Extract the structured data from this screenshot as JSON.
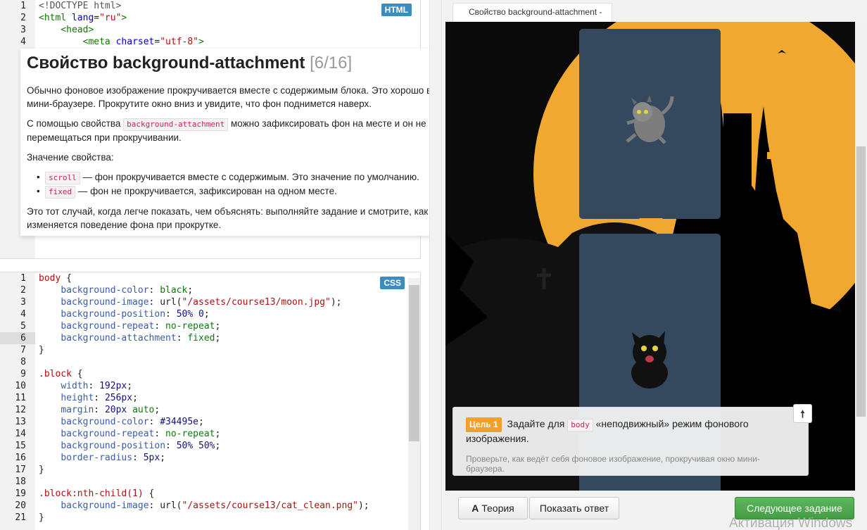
{
  "html_editor": {
    "badge": "HTML",
    "lines": [
      {
        "n": "1",
        "parts": [
          {
            "c": "t-doc",
            "t": "<!DOCTYPE html>"
          }
        ]
      },
      {
        "n": "2",
        "parts": [
          {
            "c": "t-tag",
            "t": "<html "
          },
          {
            "c": "t-attr",
            "t": "lang"
          },
          {
            "c": "t-plain",
            "t": "="
          },
          {
            "c": "t-str",
            "t": "\"ru\""
          },
          {
            "c": "t-tag",
            "t": ">"
          }
        ]
      },
      {
        "n": "3",
        "parts": [
          {
            "c": "t-plain",
            "t": "    "
          },
          {
            "c": "t-tag",
            "t": "<head>"
          }
        ]
      },
      {
        "n": "4",
        "parts": [
          {
            "c": "t-plain",
            "t": "        "
          },
          {
            "c": "t-tag",
            "t": "<meta "
          },
          {
            "c": "t-attr",
            "t": "charset"
          },
          {
            "c": "t-plain",
            "t": "="
          },
          {
            "c": "t-str",
            "t": "\"utf-8\""
          },
          {
            "c": "t-tag",
            "t": ">"
          }
        ]
      }
    ],
    "hidden_line_numbers": [
      "1",
      "1",
      "1",
      "1"
    ]
  },
  "theory": {
    "title": "Свойство background-attachment",
    "counter": "[6/16]",
    "p1": "Обычно фоновое изображение прокручивается вместе с содержимым блока. Это хорошо видно в мини-браузере. Прокрутите окно вниз и увидите, что фон поднимется наверх.",
    "p2_before": "С помощью свойства",
    "p2_code": "background-attachment",
    "p2_after": "можно зафиксировать фон на месте и он не будет перемещаться при прокручивании.",
    "p3": "Значение свойства:",
    "items": [
      {
        "code": "scroll",
        "text": "— фон прокручивается вместе с содержимым. Это значение по умолчанию."
      },
      {
        "code": "fixed",
        "text": "— фон не прокручивается, зафиксирован на одном месте."
      }
    ],
    "p4": "Это тот случай, когда легче показать, чем объяснять: выполняйте задание и смотрите, как изменяется поведение фона при прокрутке."
  },
  "css_editor": {
    "badge": "CSS",
    "active_line": "6",
    "lines": [
      {
        "n": "1",
        "parts": [
          {
            "c": "t-sel",
            "t": "body"
          },
          {
            "c": "t-plain",
            "t": " {"
          }
        ]
      },
      {
        "n": "2",
        "parts": [
          {
            "c": "t-plain",
            "t": "    "
          },
          {
            "c": "t-prop",
            "t": "background-color"
          },
          {
            "c": "t-plain",
            "t": ": "
          },
          {
            "c": "t-kw",
            "t": "black"
          },
          {
            "c": "t-plain",
            "t": ";"
          }
        ]
      },
      {
        "n": "3",
        "parts": [
          {
            "c": "t-plain",
            "t": "    "
          },
          {
            "c": "t-prop",
            "t": "background-image"
          },
          {
            "c": "t-plain",
            "t": ": url("
          },
          {
            "c": "t-str",
            "t": "\"/assets/course13/moon.jpg\""
          },
          {
            "c": "t-plain",
            "t": ");"
          }
        ]
      },
      {
        "n": "4",
        "parts": [
          {
            "c": "t-plain",
            "t": "    "
          },
          {
            "c": "t-prop",
            "t": "background-position"
          },
          {
            "c": "t-plain",
            "t": ": "
          },
          {
            "c": "t-num",
            "t": "50% 0"
          },
          {
            "c": "t-plain",
            "t": ";"
          }
        ]
      },
      {
        "n": "5",
        "parts": [
          {
            "c": "t-plain",
            "t": "    "
          },
          {
            "c": "t-prop",
            "t": "background-repeat"
          },
          {
            "c": "t-plain",
            "t": ": "
          },
          {
            "c": "t-kw",
            "t": "no-repeat"
          },
          {
            "c": "t-plain",
            "t": ";"
          }
        ]
      },
      {
        "n": "6",
        "parts": [
          {
            "c": "t-plain",
            "t": "    "
          },
          {
            "c": "t-prop",
            "t": "background-attachment"
          },
          {
            "c": "t-plain",
            "t": ": "
          },
          {
            "c": "t-kw",
            "t": "fixed"
          },
          {
            "c": "t-plain",
            "t": ";"
          }
        ]
      },
      {
        "n": "7",
        "parts": [
          {
            "c": "t-plain",
            "t": "}"
          }
        ]
      },
      {
        "n": "8",
        "parts": []
      },
      {
        "n": "9",
        "parts": [
          {
            "c": "t-sel",
            "t": ".block"
          },
          {
            "c": "t-plain",
            "t": " {"
          }
        ]
      },
      {
        "n": "10",
        "parts": [
          {
            "c": "t-plain",
            "t": "    "
          },
          {
            "c": "t-prop",
            "t": "width"
          },
          {
            "c": "t-plain",
            "t": ": "
          },
          {
            "c": "t-num",
            "t": "192px"
          },
          {
            "c": "t-plain",
            "t": ";"
          }
        ]
      },
      {
        "n": "11",
        "parts": [
          {
            "c": "t-plain",
            "t": "    "
          },
          {
            "c": "t-prop",
            "t": "height"
          },
          {
            "c": "t-plain",
            "t": ": "
          },
          {
            "c": "t-num",
            "t": "256px"
          },
          {
            "c": "t-plain",
            "t": ";"
          }
        ]
      },
      {
        "n": "12",
        "parts": [
          {
            "c": "t-plain",
            "t": "    "
          },
          {
            "c": "t-prop",
            "t": "margin"
          },
          {
            "c": "t-plain",
            "t": ": "
          },
          {
            "c": "t-num",
            "t": "20px"
          },
          {
            "c": "t-plain",
            "t": " "
          },
          {
            "c": "t-kw",
            "t": "auto"
          },
          {
            "c": "t-plain",
            "t": ";"
          }
        ]
      },
      {
        "n": "13",
        "parts": [
          {
            "c": "t-plain",
            "t": "    "
          },
          {
            "c": "t-prop",
            "t": "background-color"
          },
          {
            "c": "t-plain",
            "t": ": "
          },
          {
            "c": "t-num",
            "t": "#34495e"
          },
          {
            "c": "t-plain",
            "t": ";"
          }
        ]
      },
      {
        "n": "14",
        "parts": [
          {
            "c": "t-plain",
            "t": "    "
          },
          {
            "c": "t-prop",
            "t": "background-repeat"
          },
          {
            "c": "t-plain",
            "t": ": "
          },
          {
            "c": "t-kw",
            "t": "no-repeat"
          },
          {
            "c": "t-plain",
            "t": ";"
          }
        ]
      },
      {
        "n": "15",
        "parts": [
          {
            "c": "t-plain",
            "t": "    "
          },
          {
            "c": "t-prop",
            "t": "background-position"
          },
          {
            "c": "t-plain",
            "t": ": "
          },
          {
            "c": "t-num",
            "t": "50% 50%"
          },
          {
            "c": "t-plain",
            "t": ";"
          }
        ]
      },
      {
        "n": "16",
        "parts": [
          {
            "c": "t-plain",
            "t": "    "
          },
          {
            "c": "t-prop",
            "t": "border-radius"
          },
          {
            "c": "t-plain",
            "t": ": "
          },
          {
            "c": "t-num",
            "t": "5px"
          },
          {
            "c": "t-plain",
            "t": ";"
          }
        ]
      },
      {
        "n": "17",
        "parts": [
          {
            "c": "t-plain",
            "t": "}"
          }
        ]
      },
      {
        "n": "18",
        "parts": []
      },
      {
        "n": "19",
        "parts": [
          {
            "c": "t-sel",
            "t": ".block:nth-child(1)"
          },
          {
            "c": "t-plain",
            "t": " {"
          }
        ]
      },
      {
        "n": "20",
        "parts": [
          {
            "c": "t-plain",
            "t": "    "
          },
          {
            "c": "t-prop",
            "t": "background-image"
          },
          {
            "c": "t-plain",
            "t": ": url("
          },
          {
            "c": "t-str",
            "t": "\"/assets/course13/cat_clean.png\""
          },
          {
            "c": "t-plain",
            "t": ");"
          }
        ]
      },
      {
        "n": "21",
        "parts": [
          {
            "c": "t-plain",
            "t": "}"
          }
        ]
      }
    ]
  },
  "preview": {
    "tab_title": "Свойство background-attachment -",
    "block_color": "#34495e",
    "moon_color": "#f0a830"
  },
  "goal": {
    "badge": "Цель 1",
    "text_before": "Задайте для",
    "code": "body",
    "text_after": "«неподвижный» режим фонового изображения.",
    "hint": "Проверьте, как ведёт себя фоновое изображение, прокручивая окно мини-браузера."
  },
  "buttons": {
    "theory": "Теория",
    "show_answer": "Показать ответ",
    "next": "Следующее задание"
  },
  "watermark": "Активация Windows"
}
